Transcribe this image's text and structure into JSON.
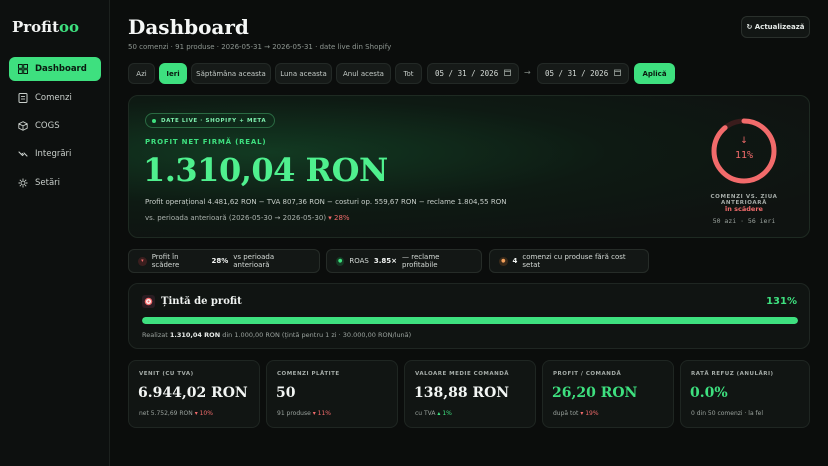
{
  "brand": {
    "name_main": "Profit",
    "name_accent": "oo"
  },
  "sidebar": {
    "items": [
      {
        "label": "Dashboard",
        "icon": "grid-icon"
      },
      {
        "label": "Comenzi",
        "icon": "receipt-icon"
      },
      {
        "label": "COGS",
        "icon": "box-icon"
      },
      {
        "label": "Integrări",
        "icon": "plug-icon"
      },
      {
        "label": "Setări",
        "icon": "gear-icon"
      }
    ]
  },
  "header": {
    "title": "Dashboard",
    "subtitle": "50 comenzi · 91 produse · 2026-05-31 → 2026-05-31 · date live din Shopify",
    "refresh_label": "↻ Actualizează"
  },
  "filters": {
    "chips": [
      "Azi",
      "Ieri",
      "Săptămâna aceasta",
      "Luna aceasta",
      "Anul acesta",
      "Tot"
    ],
    "active": "Ieri",
    "date_from": "05 / 31 / 2026",
    "date_to": "05 / 31 / 2026",
    "arrow": "→",
    "apply_label": "Aplică"
  },
  "hero": {
    "badge": "DATE LIVE · SHOPIFY + META",
    "label": "PROFIT NET FIRMĂ (REAL)",
    "value": "1.310,04 RON",
    "breakdown": "Profit operațional 4.481,62 RON − TVA 807,36 RON − costuri op. 559,67 RON − reclame 1.804,55 RON",
    "compare_text": "vs. perioada anterioară (2026-05-30 → 2026-05-30)",
    "compare_delta": "▾ 28%",
    "ring": {
      "arrow": "↓",
      "percent_text": "11%",
      "percent_value": 0.89,
      "label": "COMENZI VS. ZIUA ANTERIOARĂ",
      "status": "în scădere",
      "counts": "50 azi · 56 ieri",
      "color": "#f26b6b"
    }
  },
  "insights": [
    {
      "icon": "trend-down-icon",
      "dot_color": "#f26b6b",
      "text_pre": "Profit în scădere",
      "bold": "28%",
      "text_post": "vs perioada anterioară"
    },
    {
      "icon": "check-icon",
      "dot_color": "#3ee07f",
      "text_pre": "ROAS",
      "bold": "3.85×",
      "text_post": "— reclame profitabile"
    },
    {
      "icon": "alert-icon",
      "dot_color": "#f2a05a",
      "text_pre": "",
      "bold": "4",
      "text_post": "comenzi cu produse fără cost setat"
    }
  ],
  "target": {
    "title": "Țintă de profit",
    "percent_text": "131%",
    "progress": 1.0,
    "note_pre": "Realizat",
    "note_bold": "1.310,04 RON",
    "note_post": "din 1.000,00 RON (țintă pentru 1 zi · 30.000,00 RON/lună)"
  },
  "kpis": [
    {
      "label": "VENIT (CU TVA)",
      "value": "6.944,02 RON",
      "sub": "net 5.752,69 RON",
      "delta": "▾ 10%",
      "delta_dir": "down",
      "accent": false
    },
    {
      "label": "COMENZI PLĂTITE",
      "value": "50",
      "sub": "91 produse",
      "delta": "▾ 11%",
      "delta_dir": "down",
      "accent": false
    },
    {
      "label": "VALOARE MEDIE COMANDĂ",
      "value": "138,88 RON",
      "sub": "cu TVA",
      "delta": "▴ 1%",
      "delta_dir": "up",
      "accent": false
    },
    {
      "label": "PROFIT / COMANDĂ",
      "value": "26,20 RON",
      "sub": "după tot",
      "delta": "▾ 19%",
      "delta_dir": "down",
      "accent": true
    },
    {
      "label": "RATĂ REFUZ (ANULĂRI)",
      "value": "0.0%",
      "sub": "0 din 50 comenzi · la fel",
      "delta": "",
      "delta_dir": "",
      "accent": true
    }
  ],
  "colors": {
    "accent": "#3ee07f",
    "negative": "#f26b6b",
    "warning": "#f2a05a",
    "background": "#0b0d0c"
  }
}
